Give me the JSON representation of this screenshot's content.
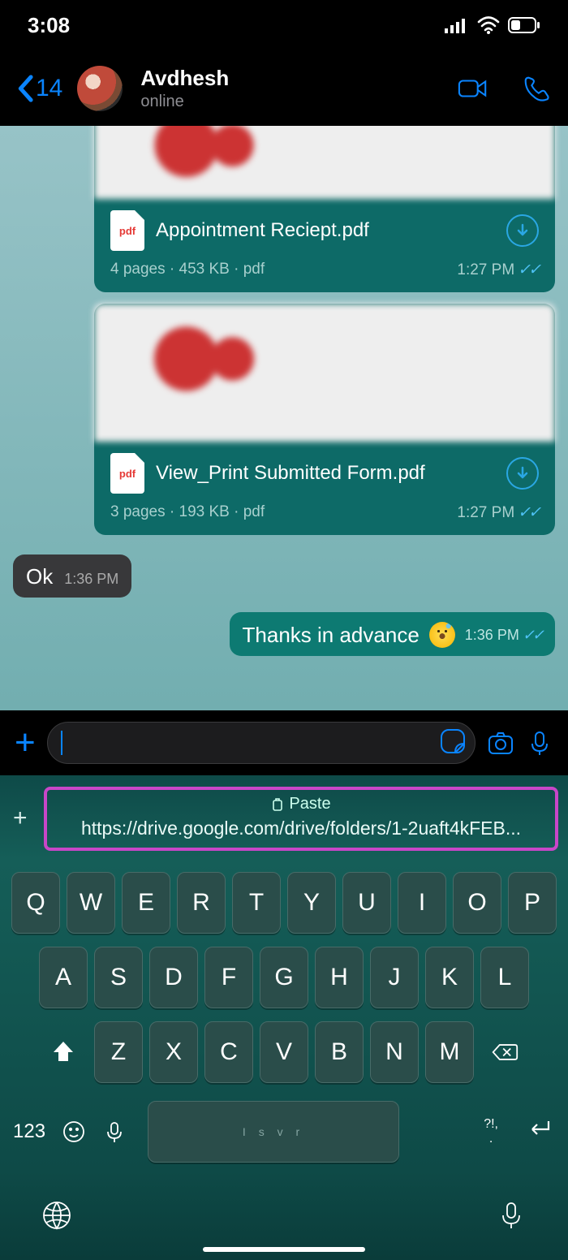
{
  "status": {
    "time": "3:08"
  },
  "nav": {
    "back_count": "14",
    "name": "Avdhesh",
    "status": "online"
  },
  "messages": {
    "doc1": {
      "name": "Appointment Reciept.pdf",
      "pages": "4 pages",
      "size": "453 KB",
      "ext": "pdf",
      "time": "1:27 PM",
      "badge": "pdf"
    },
    "doc2": {
      "name": "View_Print Submitted Form.pdf",
      "pages": "3 pages",
      "size": "193 KB",
      "ext": "pdf",
      "time": "1:27 PM",
      "badge": "pdf"
    },
    "in1": {
      "text": "Ok",
      "time": "1:36 PM"
    },
    "out1": {
      "text": "Thanks in advance",
      "time": "1:36 PM"
    }
  },
  "paste": {
    "label": "Paste",
    "url": "https://drive.google.com/drive/folders/1-2uaft4kFEB..."
  },
  "keyboard": {
    "row1": [
      "Q",
      "W",
      "E",
      "R",
      "T",
      "Y",
      "U",
      "I",
      "O",
      "P"
    ],
    "row2": [
      "A",
      "S",
      "D",
      "F",
      "G",
      "H",
      "J",
      "K",
      "L"
    ],
    "row3": [
      "Z",
      "X",
      "C",
      "V",
      "B",
      "N",
      "M"
    ],
    "numkey": "123",
    "punct1": "?!,",
    "punct2": ".",
    "space_hint": "I  s   v   r"
  }
}
